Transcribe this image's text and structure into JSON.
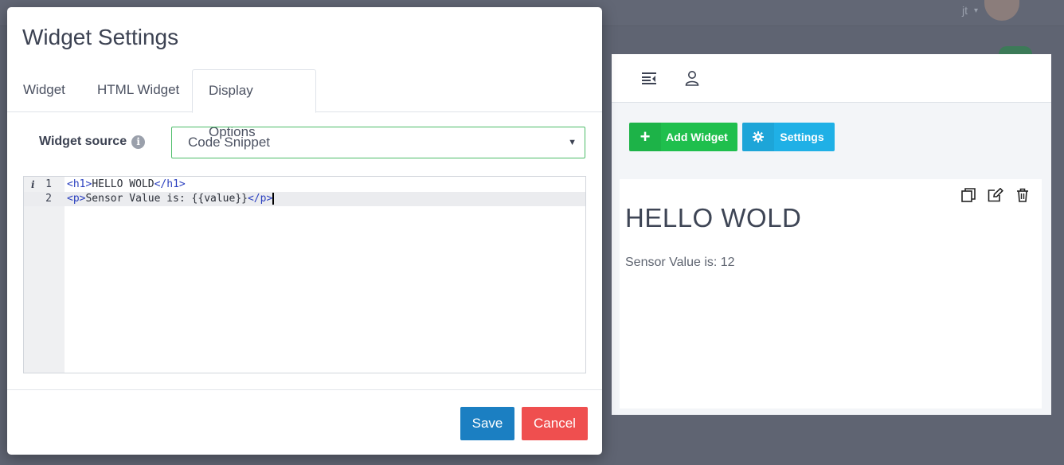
{
  "background": {
    "user_initials": "jt",
    "avatar_icon": "user-avatar"
  },
  "modal": {
    "title": "Widget Settings",
    "tabs": [
      {
        "label": "Widget",
        "active": false
      },
      {
        "label": "HTML Widget",
        "active": false
      },
      {
        "label": "Display Options",
        "active": true
      }
    ],
    "widget_source": {
      "label": "Widget source",
      "info_icon": "info-icon",
      "selected": "Code Snippet"
    },
    "editor": {
      "lines": [
        {
          "number": "1",
          "open_tag": "<h1>",
          "text": "HELLO WOLD",
          "close_tag": "</h1>",
          "marker": "i"
        },
        {
          "number": "2",
          "open_tag": "<p>",
          "text": "Sensor Value is: {{value}}",
          "close_tag": "</p>",
          "marker": ""
        }
      ]
    },
    "footer": {
      "save_label": "Save",
      "cancel_label": "Cancel"
    }
  },
  "dashboard": {
    "toolbar_icons": [
      "collapse-menu-icon",
      "user-icon"
    ],
    "add_widget_label": "Add Widget",
    "settings_label": "Settings",
    "widget_preview": {
      "heading": "HELLO WOLD",
      "paragraph": "Sensor Value is: 12",
      "tool_icons": [
        "copy-icon",
        "edit-icon",
        "trash-icon"
      ]
    }
  },
  "colors": {
    "overlay": "#5f6472",
    "add_button": "#1fbf4d",
    "settings_button": "#1fb0e6",
    "save_button": "#1b7fc2",
    "cancel_button": "#ef4f4f",
    "select_border": "#4cbc68",
    "code_tag": "#2a3fbf"
  }
}
